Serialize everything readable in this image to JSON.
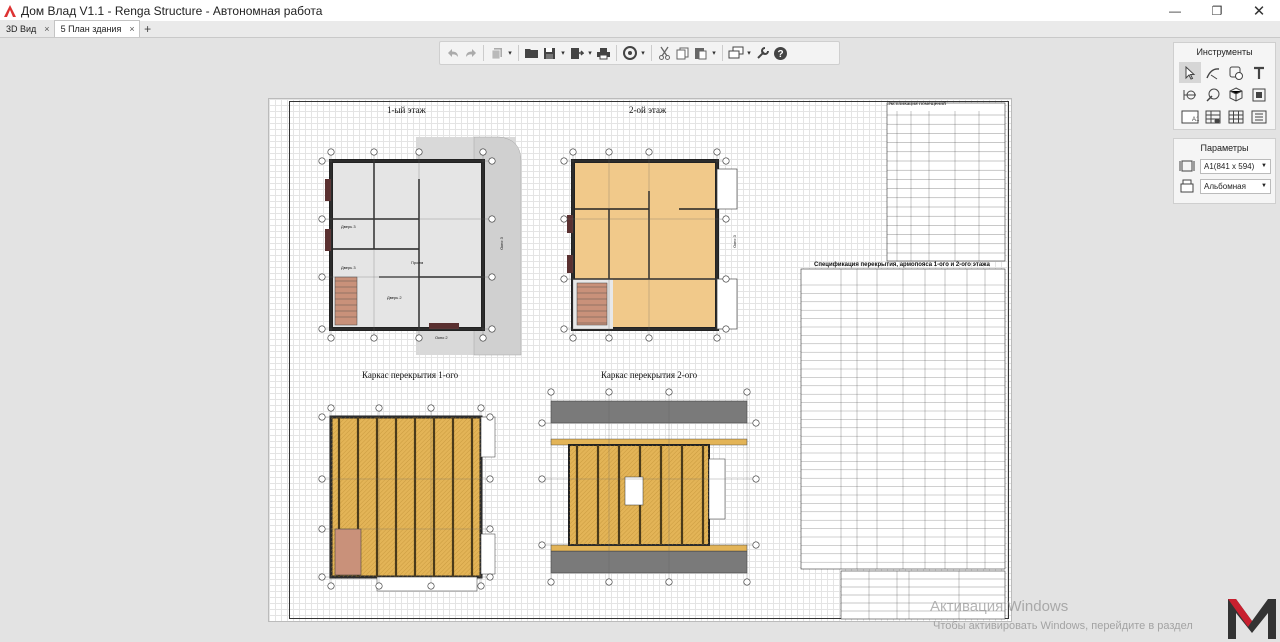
{
  "window": {
    "title": "Дом Влад V1.1 - Renga Structure - Автономная работа"
  },
  "tabs": [
    {
      "label": "3D Вид",
      "close": "×"
    },
    {
      "label": "5 План здания",
      "close": "×"
    }
  ],
  "tab_add": "+",
  "panels": {
    "tools_title": "Инструменты",
    "params_title": "Параметры",
    "sheet_format": "A1(841 x 594)",
    "orientation": "Альбомная"
  },
  "drawing": {
    "titles": {
      "floor1": "1-ый этаж",
      "floor2": "2-ой этаж",
      "frame1": "Каркас перекрытия 1-ого",
      "frame2": "Каркас перекрытия 2-ого",
      "spec_table": "Спецификация перекрытия, армопояса 1-ого и 2-ого этажа",
      "explication": "Экспликация помещений"
    },
    "rooms1": [
      "Дверь 3",
      "Дверь 3",
      "Дверь 2",
      "Проем",
      "Окно 3",
      "Окно 2"
    ],
    "rooms2": [
      "Окно 3"
    ]
  },
  "watermark": {
    "title": "Активация Windows",
    "subtitle": "Чтобы активировать Windows, перейдите в раздел"
  },
  "colors": {
    "wood": "#e3b457",
    "floor_fill": "#f1c98a",
    "wall": "#2b2b2b",
    "beam_dark": "#6b6b6b",
    "logo_red": "#c8202f"
  }
}
